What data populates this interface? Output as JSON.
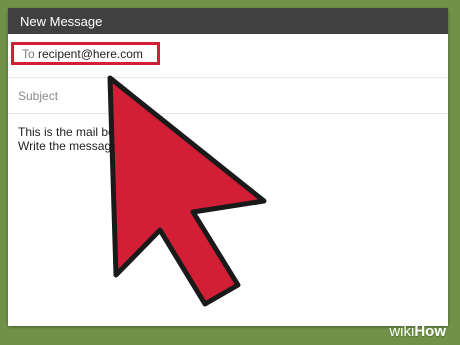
{
  "compose": {
    "title": "New Message",
    "to_label": "To",
    "to_value": "recipent@here.com",
    "subject_placeholder": "Subject",
    "body_lines": [
      "This is the  mail bo",
      "Write the message"
    ]
  },
  "overlay": {
    "cursor": "mouse-pointer-arrow",
    "cursor_color": "#d31f35",
    "highlight_color": "#d31f35"
  },
  "watermark": {
    "wiki": "wiki",
    "how": "How"
  },
  "colors": {
    "background": "#6f9248",
    "title_bar": "#404040",
    "window": "#ffffff"
  }
}
